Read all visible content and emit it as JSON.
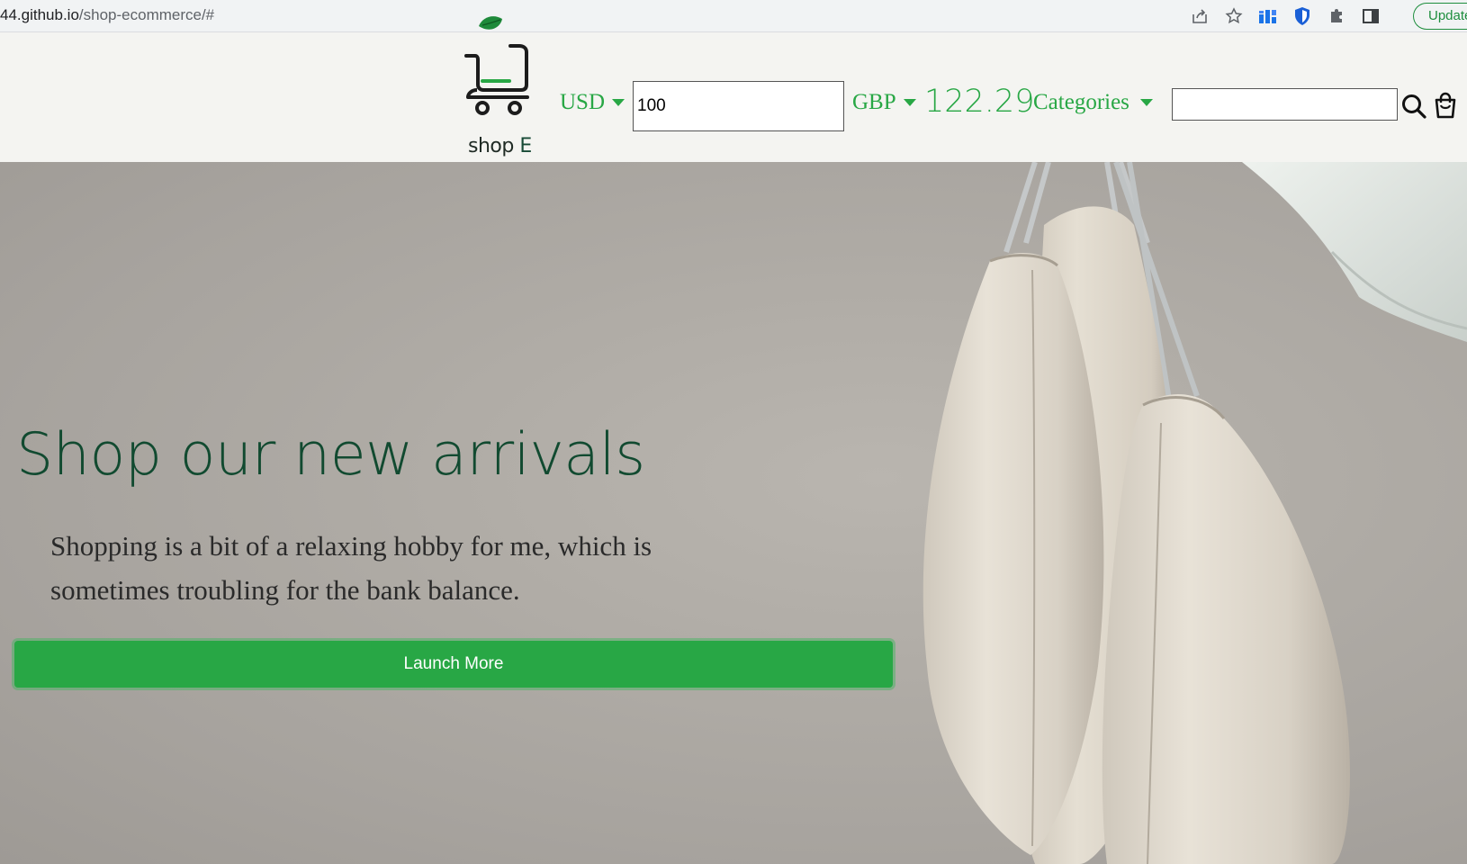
{
  "browser": {
    "url_host": "44.github.io",
    "url_path": "/shop-ecommerce/#",
    "update_label": "Update"
  },
  "navbar": {
    "logo_text_main": "shop ",
    "logo_text_accent": "E",
    "from_currency": "USD",
    "amount_value": "100",
    "to_currency": "GBP",
    "converted_amount": "122.29",
    "categories_label": "Categories",
    "search_value": ""
  },
  "hero": {
    "title": "Shop our new arrivals",
    "text": "Shopping is a bit of a relaxing hobby for me, which is sometimes troubling for the bank balance.",
    "button_label": "Launch More"
  },
  "icons": [
    "share-icon",
    "star-icon",
    "dashboard-icon",
    "shield-icon",
    "puzzle-icon",
    "sidepanel-icon",
    "search-icon",
    "cart-icon",
    "logo-cart-icon"
  ],
  "colors": {
    "brand_green": "#28a745",
    "title_green": "#114a30",
    "navbar_bg": "#f4f4f1"
  }
}
